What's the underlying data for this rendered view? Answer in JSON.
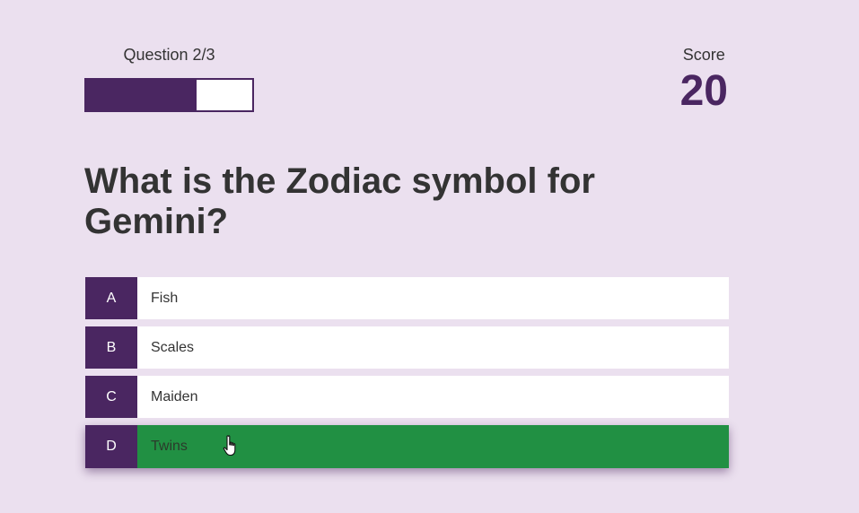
{
  "hud": {
    "progress_text": "Question 2/3",
    "progress_fraction": 0.667,
    "score_label": "Score",
    "score_value": "20"
  },
  "question": {
    "text": "What is the Zodiac symbol for Gemini?"
  },
  "choices": [
    {
      "prefix": "A",
      "text": "Fish",
      "state": "default"
    },
    {
      "prefix": "B",
      "text": "Scales",
      "state": "default"
    },
    {
      "prefix": "C",
      "text": "Maiden",
      "state": "default"
    },
    {
      "prefix": "D",
      "text": "Twins",
      "state": "correct"
    }
  ],
  "colors": {
    "background": "#ebe0ef",
    "accent": "#4a2661",
    "correct": "#219043"
  },
  "icons": {
    "cursor": "hand-pointer-icon"
  }
}
